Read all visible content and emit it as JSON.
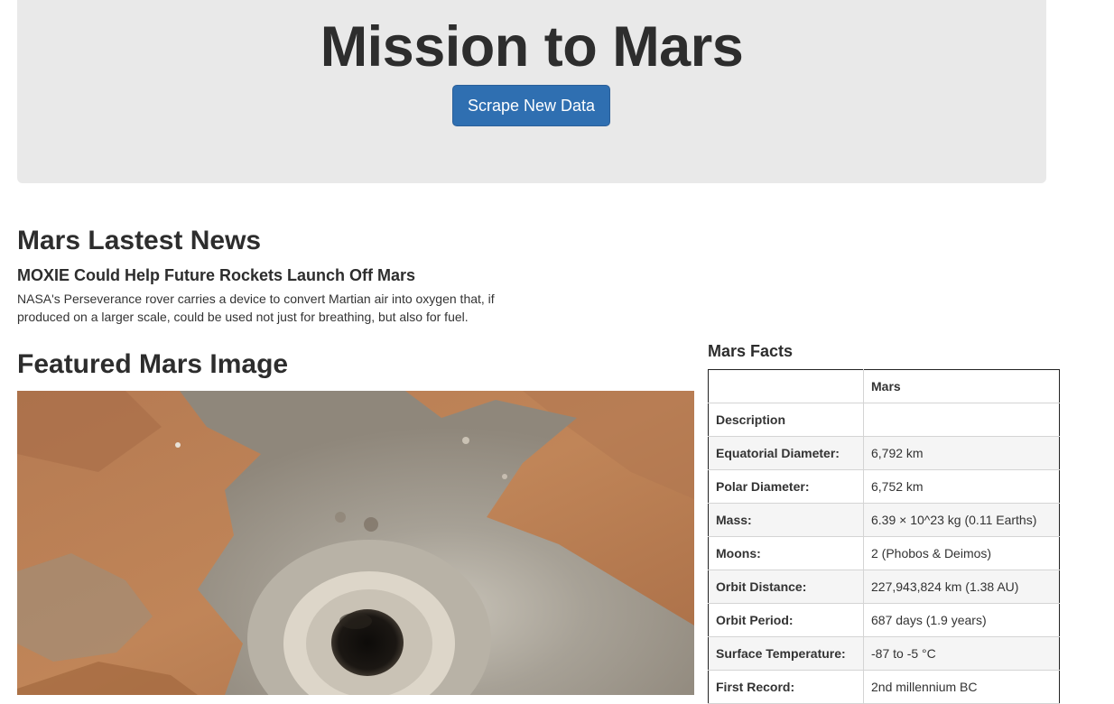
{
  "header": {
    "title": "Mission to Mars",
    "scrape_button_label": "Scrape New Data"
  },
  "news": {
    "heading": "Mars Lastest News",
    "title": "MOXIE Could Help Future Rockets Launch Off Mars",
    "teaser": "NASA's Perseverance rover carries a device to convert Martian air into oxygen that, if produced on a larger scale, could be used not just for breathing, but also for fuel."
  },
  "featured_image": {
    "heading": "Featured Mars Image"
  },
  "facts": {
    "heading": "Mars Facts",
    "column_header": "Mars",
    "rows": [
      {
        "label": "Description",
        "value": ""
      },
      {
        "label": "Equatorial Diameter:",
        "value": "6,792 km"
      },
      {
        "label": "Polar Diameter:",
        "value": "6,752 km"
      },
      {
        "label": "Mass:",
        "value": "6.39 × 10^23 kg (0.11 Earths)"
      },
      {
        "label": "Moons:",
        "value": "2 (Phobos & Deimos)"
      },
      {
        "label": "Orbit Distance:",
        "value": "227,943,824 km (1.38 AU)"
      },
      {
        "label": "Orbit Period:",
        "value": "687 days (1.9 years)"
      },
      {
        "label": "Surface Temperature:",
        "value": "-87 to -5 °C"
      },
      {
        "label": "First Record:",
        "value": "2nd millennium BC"
      }
    ]
  },
  "colors": {
    "jumbotron_bg": "#e9e9e9",
    "button_bg": "#2f6fb1",
    "mars_terrain": "#b87a4e",
    "drill_dust": "#9f9a91"
  }
}
